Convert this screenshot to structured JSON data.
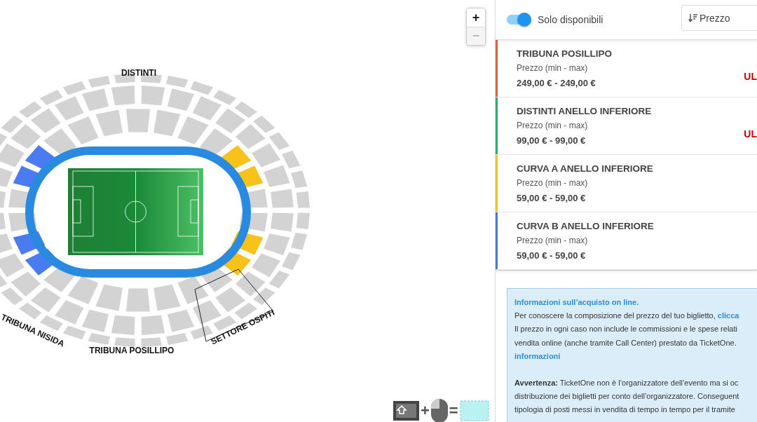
{
  "map": {
    "zoom": [
      {
        "label": "+",
        "disabled": false
      },
      {
        "label": "−",
        "disabled": true
      }
    ],
    "sections": [
      {
        "label": "DISTINTI"
      },
      {
        "label": "TRIBUNA NISIDA"
      },
      {
        "label": "TRIBUNA POSILLIPO"
      },
      {
        "label": "SETTORE OSPITI"
      }
    ],
    "legend": {
      "plus": "+",
      "equals": "="
    }
  },
  "filters": {
    "available_only": {
      "label": "Solo disponibili",
      "on": true
    },
    "sort": {
      "label": "Prezzo"
    }
  },
  "categories": [
    {
      "name": "TRIBUNA POSILLIPO",
      "price_label": "Prezzo (min - max)",
      "price": "249,00 € - 249,00 €",
      "status": "UL",
      "color": "#d9663a"
    },
    {
      "name": "DISTINTI ANELLO INFERIORE",
      "price_label": "Prezzo (min - max)",
      "price": "99,00 € - 99,00 €",
      "status": "UL",
      "color": "#2bab6e"
    },
    {
      "name": "CURVA A ANELLO INFERIORE",
      "price_label": "Prezzo (min - max)",
      "price": "59,00 € - 59,00 €",
      "color": "#eec52a"
    },
    {
      "name": "CURVA B ANELLO INFERIORE",
      "price_label": "Prezzo (min - max)",
      "price": "59,00 € - 59,00 €",
      "color": "#4a7bd0"
    }
  ],
  "info": {
    "title": "Informazioni sull’acquisto on line.",
    "paragraphs": [
      {
        "lines": [
          {
            "text": "Per conoscere la composizione del prezzo del tuo biglietto, ",
            "link": "clicca"
          },
          {
            "text": "Il prezzo in ogni caso non include le commissioni e le spese relati"
          },
          {
            "text": "vendita online (anche tramite Call Center) prestato da TicketOne."
          },
          {
            "link": "informazioni"
          }
        ]
      },
      {
        "lines": [
          {
            "text": "**Avvertenza:** TicketOne non è l’organizzatore dell’evento ma si oc"
          },
          {
            "text": "distribuzione dei biglietti per conto dell’organizzatore. Conseguent"
          },
          {
            "text": "tipologia di posti messi in vendita di tempo in tempo per il tramite"
          }
        ]
      }
    ]
  }
}
